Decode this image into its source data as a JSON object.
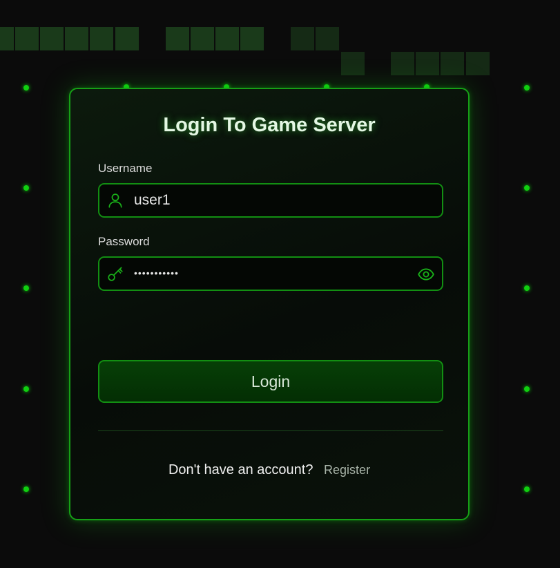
{
  "title": "Login To Game Server",
  "username": {
    "label": "Username",
    "value": "user1"
  },
  "password": {
    "label": "Password",
    "masked_value": "•••••••••••"
  },
  "login_button": "Login",
  "footer": {
    "prompt": "Don't have an account?",
    "register_link": "Register"
  },
  "colors": {
    "accent": "#16a016",
    "dot": "#10d010",
    "button_bg": "#053705"
  },
  "icons": {
    "username": "user-icon",
    "password": "key-icon",
    "visibility": "eye-icon"
  }
}
